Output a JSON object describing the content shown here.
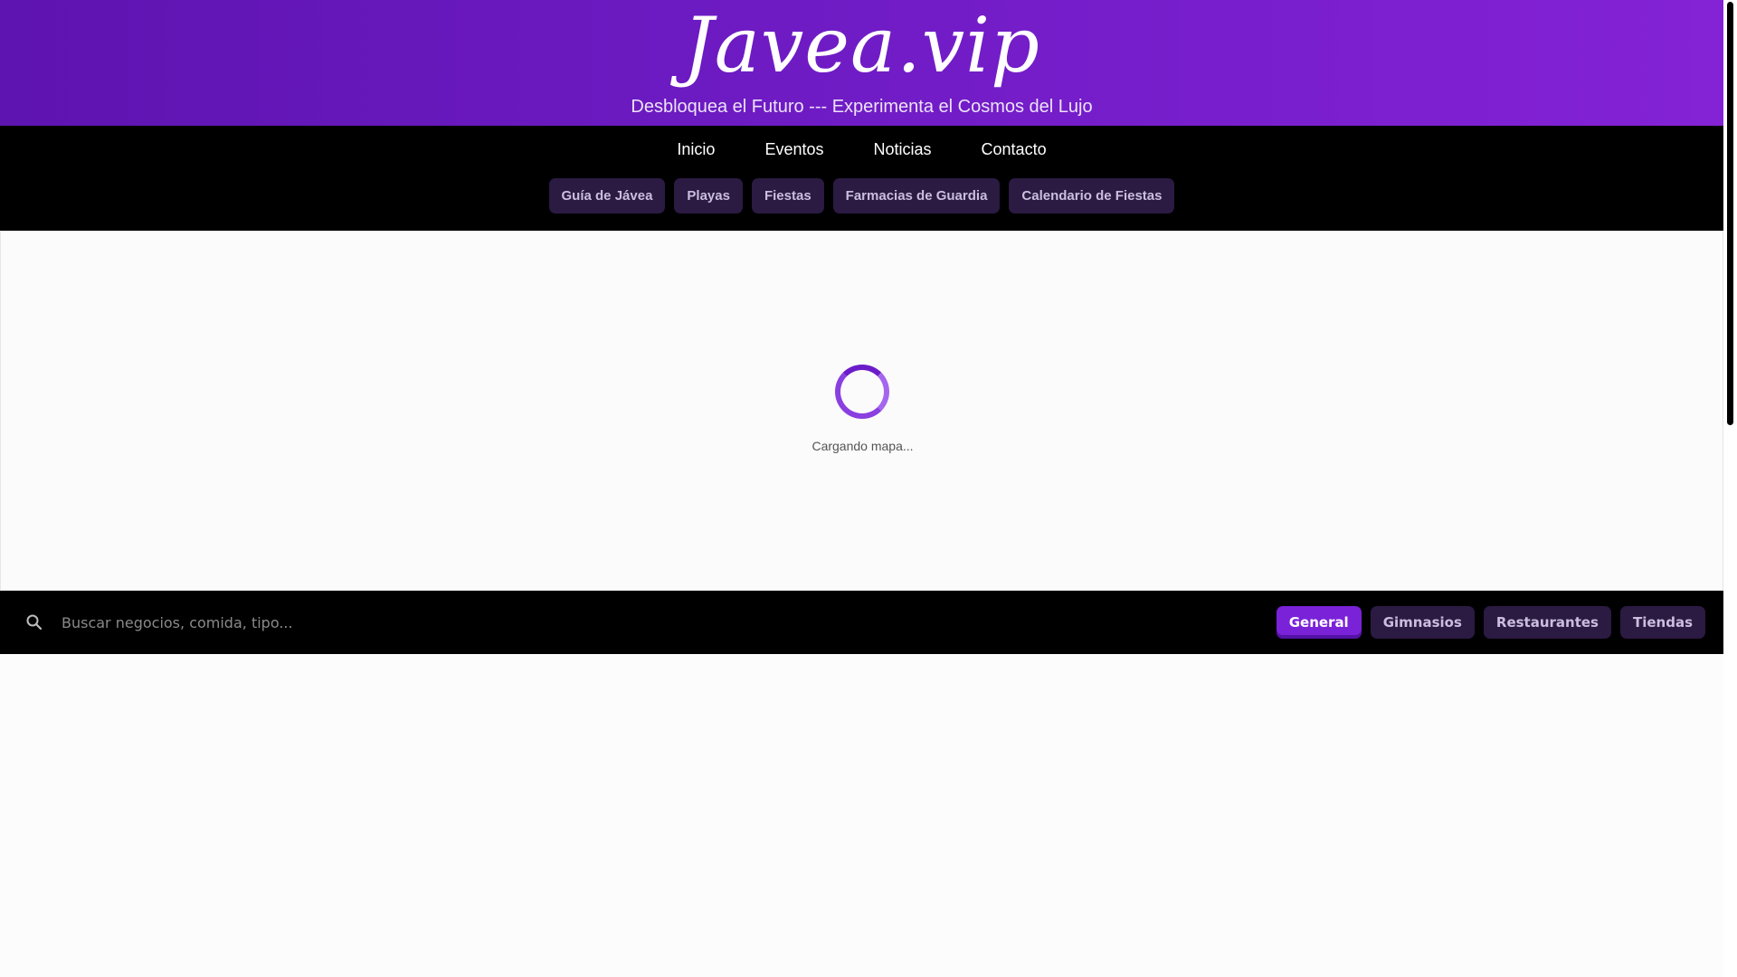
{
  "header": {
    "logo": "Javea.vip",
    "tagline": "Desbloquea el Futuro --- Experimenta el Cosmos del Lujo"
  },
  "nav": {
    "main": [
      {
        "label": "Inicio"
      },
      {
        "label": "Eventos"
      },
      {
        "label": "Noticias"
      },
      {
        "label": "Contacto"
      }
    ],
    "sub": [
      {
        "label": "Guía de Jávea"
      },
      {
        "label": "Playas"
      },
      {
        "label": "Fiestas"
      },
      {
        "label": "Farmacias de Guardia"
      },
      {
        "label": "Calendario de Fiestas"
      }
    ]
  },
  "map": {
    "loading_text": "Cargando mapa..."
  },
  "search": {
    "placeholder": "Buscar negocios, comida, tipo...",
    "value": "",
    "filters": [
      {
        "label": "General",
        "active": true
      },
      {
        "label": "Gimnasios",
        "active": false
      },
      {
        "label": "Restaurantes",
        "active": false
      },
      {
        "label": "Tiendas",
        "active": false
      }
    ]
  },
  "colors": {
    "header_gradient_start": "#5e14b0",
    "header_gradient_end": "#8422d6",
    "chip_bg": "#2b1a42",
    "active_filter": "#7a22d8",
    "spinner": "#8a3fe0"
  },
  "icons": {
    "search": "search-icon",
    "spinner": "loading-spinner"
  }
}
